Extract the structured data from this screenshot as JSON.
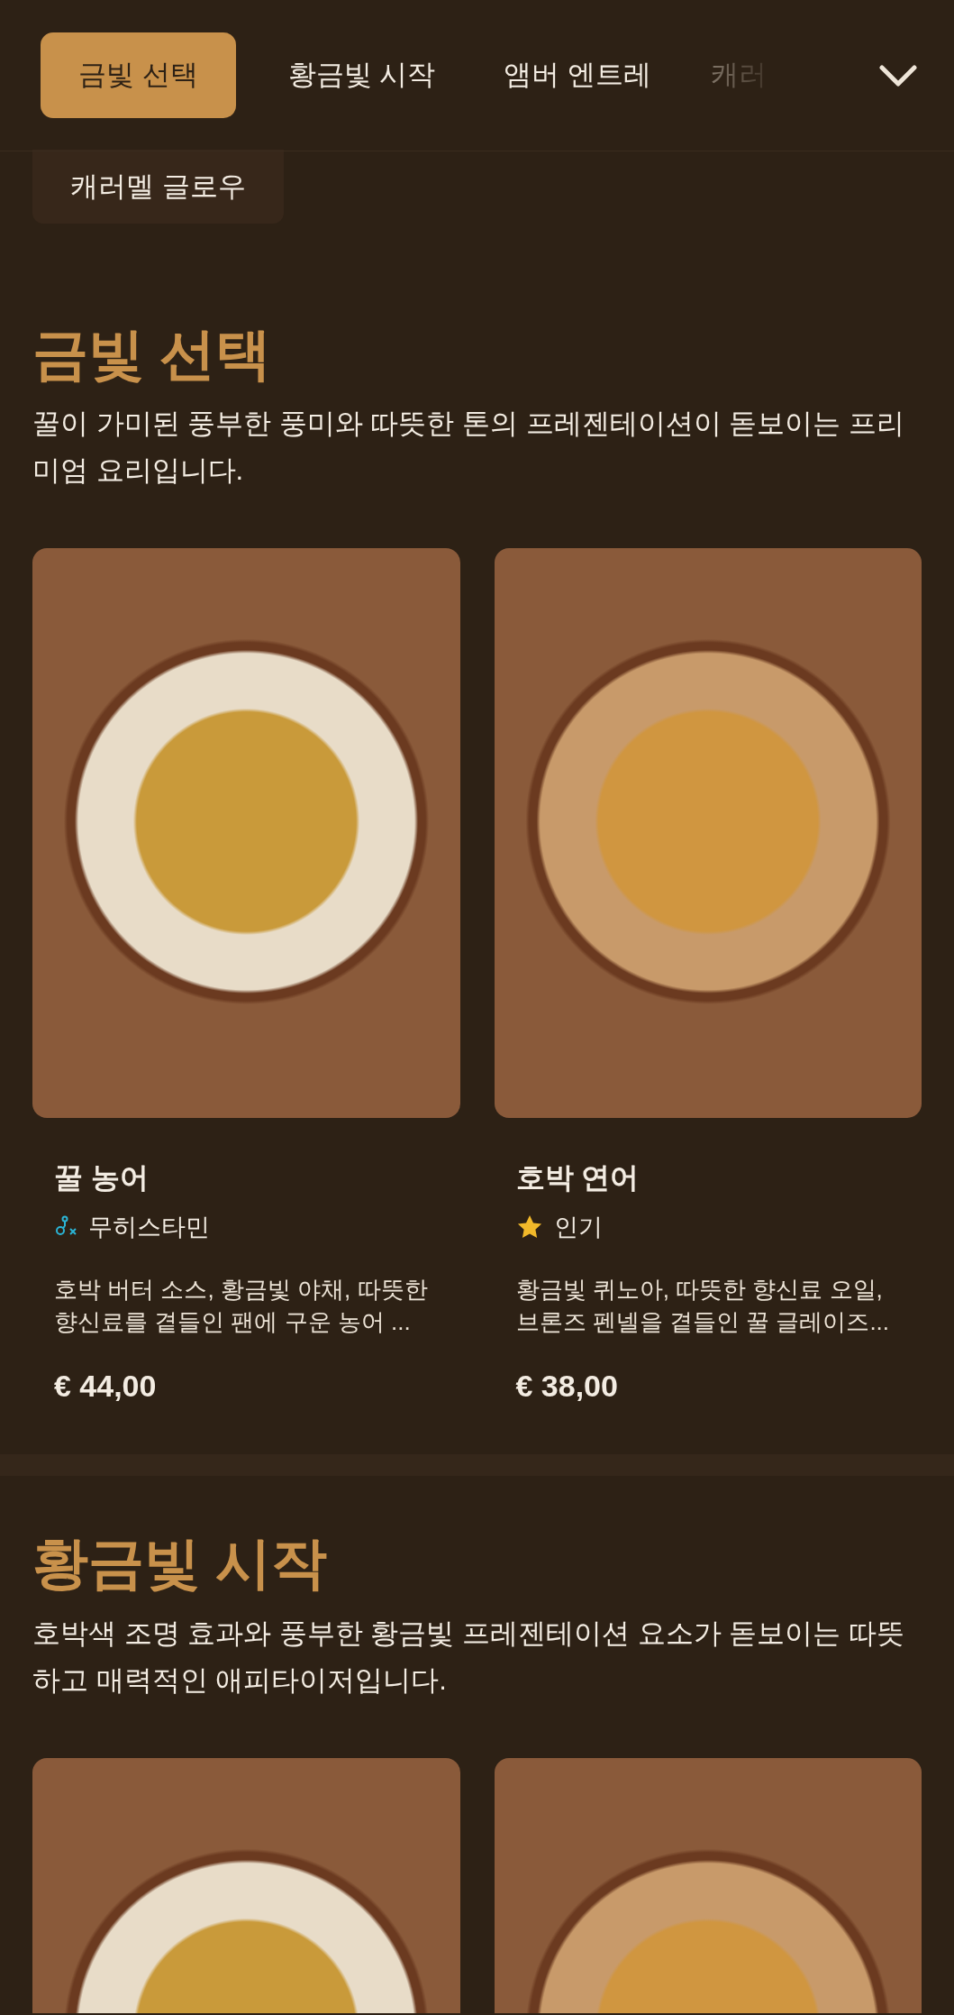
{
  "nav": {
    "tabs": [
      {
        "label": "금빛 선택",
        "selected": true
      },
      {
        "label": "황금빛 시작",
        "selected": false
      },
      {
        "label": "앰버 엔트레",
        "selected": false
      },
      {
        "label": "캐러",
        "selected": false
      }
    ],
    "overflow_chip": {
      "label": "캐러멜 글로우"
    }
  },
  "sections": [
    {
      "title": "금빛 선택",
      "description": "꿀이 가미된 풍부한 풍미와 따뜻한 톤의 프레젠테이션이 돋보이는 프리미엄 요리입니다.",
      "dishes": [
        {
          "photo": true,
          "name": "꿀 농어",
          "tag": {
            "kind": "histamine-free",
            "label": "무히스타민"
          },
          "description": "호박 버터 소스, 황금빛 야채, 따뜻한 향신료를 곁들인 팬에 구운 농어 ...",
          "price": "€ 44,00"
        },
        {
          "photo": true,
          "name": "호박 연어",
          "tag": {
            "kind": "popular",
            "label": "인기"
          },
          "description": "황금빛 퀴노아, 따뜻한 향신료 오일, 브론즈 펜넬을 곁들인 꿀 글레이즈...",
          "price": "€ 38,00"
        }
      ]
    },
    {
      "title": "황금빛 시작",
      "description": "호박색 조명 효과와 풍부한 황금빛 프레젠테이션 요소가 돋보이는 따뜻하고 매력적인 애피타이저입니다.",
      "dishes": [
        {
          "photo": true
        },
        {
          "photo": true
        }
      ]
    }
  ]
}
